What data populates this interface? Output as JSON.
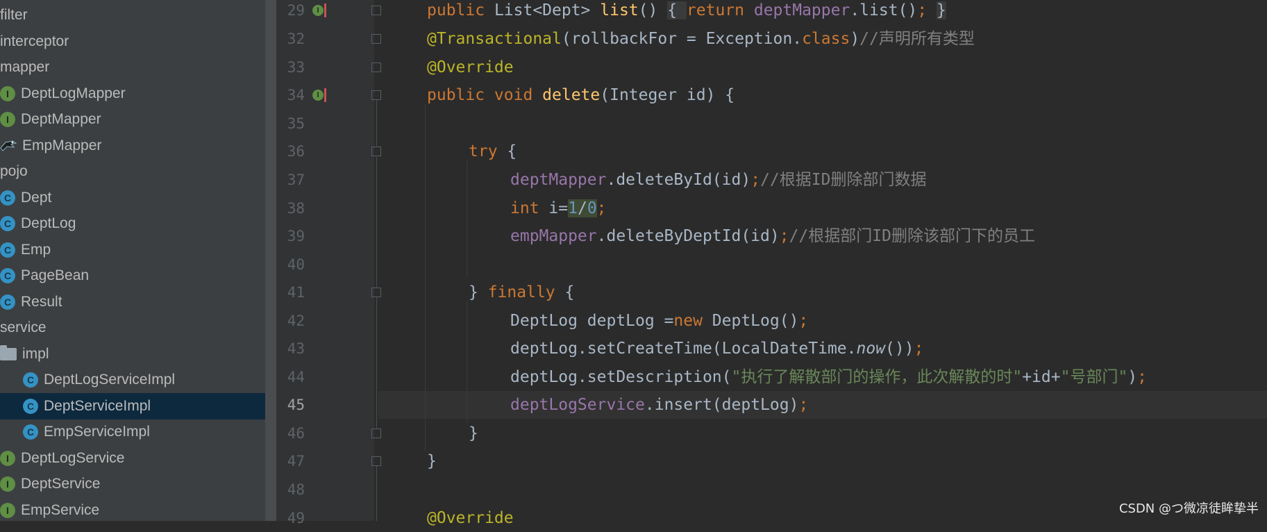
{
  "project_tree": {
    "items": [
      {
        "label": "filter",
        "type": "package"
      },
      {
        "label": "interceptor",
        "type": "package"
      },
      {
        "label": "mapper",
        "type": "package"
      },
      {
        "label": "DeptLogMapper",
        "type": "interface",
        "icon": "I"
      },
      {
        "label": "DeptMapper",
        "type": "interface",
        "icon": "I"
      },
      {
        "label": "EmpMapper",
        "type": "mapper"
      },
      {
        "label": "pojo",
        "type": "package"
      },
      {
        "label": "Dept",
        "type": "class",
        "icon": "C"
      },
      {
        "label": "DeptLog",
        "type": "class",
        "icon": "C"
      },
      {
        "label": "Emp",
        "type": "class",
        "icon": "C"
      },
      {
        "label": "PageBean",
        "type": "class",
        "icon": "C"
      },
      {
        "label": "Result",
        "type": "class",
        "icon": "C"
      },
      {
        "label": "service",
        "type": "package"
      },
      {
        "label": "impl",
        "type": "folder"
      },
      {
        "label": "DeptLogServiceImpl",
        "type": "class",
        "icon": "C"
      },
      {
        "label": "DeptServiceImpl",
        "type": "class",
        "icon": "C",
        "selected": true
      },
      {
        "label": "EmpServiceImpl",
        "type": "class",
        "icon": "C"
      },
      {
        "label": "DeptLogService",
        "type": "interface",
        "icon": "I"
      },
      {
        "label": "DeptService",
        "type": "interface",
        "icon": "I"
      },
      {
        "label": "EmpService",
        "type": "interface",
        "icon": "I"
      }
    ]
  },
  "editor": {
    "current_line": "45",
    "line_numbers": [
      "29",
      "32",
      "33",
      "34",
      "35",
      "36",
      "37",
      "38",
      "39",
      "40",
      "41",
      "42",
      "43",
      "44",
      "45",
      "46",
      "47",
      "48",
      "49"
    ],
    "code": {
      "l29": {
        "t1": "public ",
        "t2": "List<Dept> ",
        "t3": "list",
        "t4": "() ",
        "t5": "{ ",
        "t6": "return ",
        "t7": "deptMapper",
        "t8": ".list()",
        "t9": "; ",
        "t10": "}"
      },
      "l32": {
        "t1": "@Transactional",
        "t2": "(rollbackFor = Exception.",
        "t3": "class",
        "t4": ")",
        "t5": "//声明所有类型"
      },
      "l33": {
        "t1": "@Override"
      },
      "l34": {
        "t1": "public void ",
        "t2": "delete",
        "t3": "(Integer id) {"
      },
      "l36": {
        "t1": "try ",
        "t2": "{"
      },
      "l37": {
        "t1": "deptMapper",
        "t2": ".deleteById(id)",
        "t3": ";",
        "t4": "//根据ID删除部门数据"
      },
      "l38": {
        "t1": "int ",
        "t2": "i=",
        "t3": "1",
        "t4": "/",
        "t5": "0",
        "t6": ";"
      },
      "l39": {
        "t1": "empMapper",
        "t2": ".deleteByDeptId(id)",
        "t3": ";",
        "t4": "//根据部门ID删除该部门下的员工"
      },
      "l41": {
        "t1": "} ",
        "t2": "finally ",
        "t3": "{"
      },
      "l42": {
        "t1": "DeptLog deptLog =",
        "t2": "new ",
        "t3": "DeptLog()",
        "t4": ";"
      },
      "l43": {
        "t1": "deptLog.setCreateTime(LocalDateTime.",
        "t2": "now",
        "t3": "())",
        "t4": ";"
      },
      "l44": {
        "t1": "deptLog.setDescription(",
        "t2": "\"执行了解散部门的操作，此次解散的时\"",
        "t3": "+id+",
        "t4": "\"号部门\"",
        "t5": ")",
        "t6": ";"
      },
      "l45": {
        "t1": "deptLogService",
        "t2": ".insert(deptLog)",
        "t3": ";"
      },
      "l46": {
        "t1": "}"
      },
      "l47": {
        "t1": "}"
      },
      "l49": {
        "t1": "@Override"
      }
    }
  },
  "watermark": "CSDN @つ微凉徒眸挚半",
  "colors": {
    "keyword": "#cc7832",
    "method": "#ffc66d",
    "field": "#9876aa",
    "string": "#6a8759",
    "comment": "#808080",
    "number": "#6897bb",
    "annotation": "#bbb529",
    "selection": "#0d293e"
  }
}
